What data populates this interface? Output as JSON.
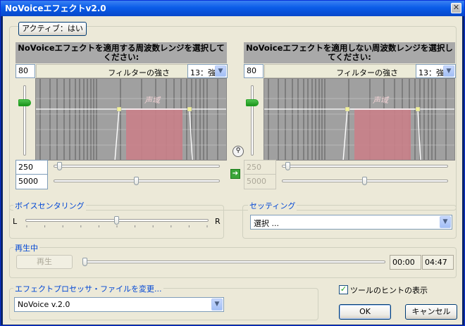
{
  "window": {
    "title": "NoVoiceエフェクトv2.0",
    "close_symbol": "✕"
  },
  "active_button": {
    "label": "アクティブ：はい"
  },
  "left_panel": {
    "header": "NoVoiceエフェクトを適用する周波数レンジを選択してください:",
    "level_value": "80",
    "filter_label": "フィルターの強さ",
    "filter_value": "13：強",
    "region_label": "声域",
    "freq_low": "250",
    "freq_high": "5000",
    "vertical_slider": 0.78,
    "low_slider": 0.02,
    "high_slider": 0.5
  },
  "right_panel": {
    "header": "NoVoiceエフェクトを適用しない周波数レンジを選択してください:",
    "level_value": "80",
    "filter_label": "フィルターの強さ",
    "filter_value": "13：強",
    "region_label": "声域",
    "freq_low": "250",
    "freq_high": "5000",
    "vertical_slider": 0.78,
    "low_slider": 0.02,
    "high_slider": 0.5
  },
  "voice_centering": {
    "title": "ボイスセンタリング",
    "left_label": "L",
    "right_label": "R",
    "value": 0.5
  },
  "settings": {
    "title": "セッティング",
    "selected": "選択 ..."
  },
  "playback": {
    "title": "再生中",
    "play_label": "再生",
    "time_current": "00:00",
    "time_total": "04:47",
    "progress": 0
  },
  "effect_file": {
    "title": "エフェクトプロセッサ・ファイルを変更...",
    "selected": "NoVoice v.2.0"
  },
  "tooltip_checkbox": {
    "label": "ツールのヒントの表示",
    "checked": true
  },
  "ok_button": {
    "label": "OK"
  },
  "cancel_button": {
    "label": "キャンセル"
  },
  "colors": {
    "title_bar": "#0a5ce8",
    "group_title": "#0046d5",
    "graph_bg": "#a0a0a0",
    "voice_region": "#c98088"
  }
}
